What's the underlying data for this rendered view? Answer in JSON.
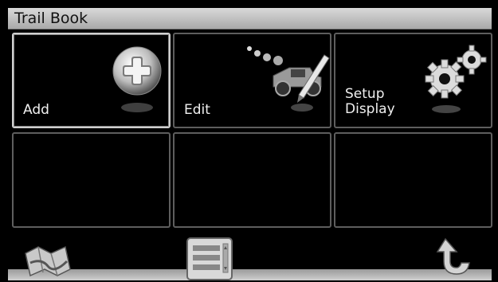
{
  "window": {
    "title": "Trail Book"
  },
  "tiles": [
    {
      "lines": [
        "Add"
      ],
      "icon": "add-plus-icon"
    },
    {
      "lines": [
        "Edit"
      ],
      "icon": "truck-pencil-icon"
    },
    {
      "lines": [
        "Setup",
        "Display"
      ],
      "icon": "gears-icon"
    },
    {
      "lines": []
    },
    {
      "lines": []
    },
    {
      "lines": []
    }
  ],
  "bottom_bar": {
    "left_icon": "map-icon",
    "center_icon": "list-menu-icon",
    "right_icon": "back-arrow-icon"
  },
  "colors": {
    "title_bar": "#c8c8c8",
    "background": "#000000",
    "tile_border": "#5e5e5e"
  }
}
